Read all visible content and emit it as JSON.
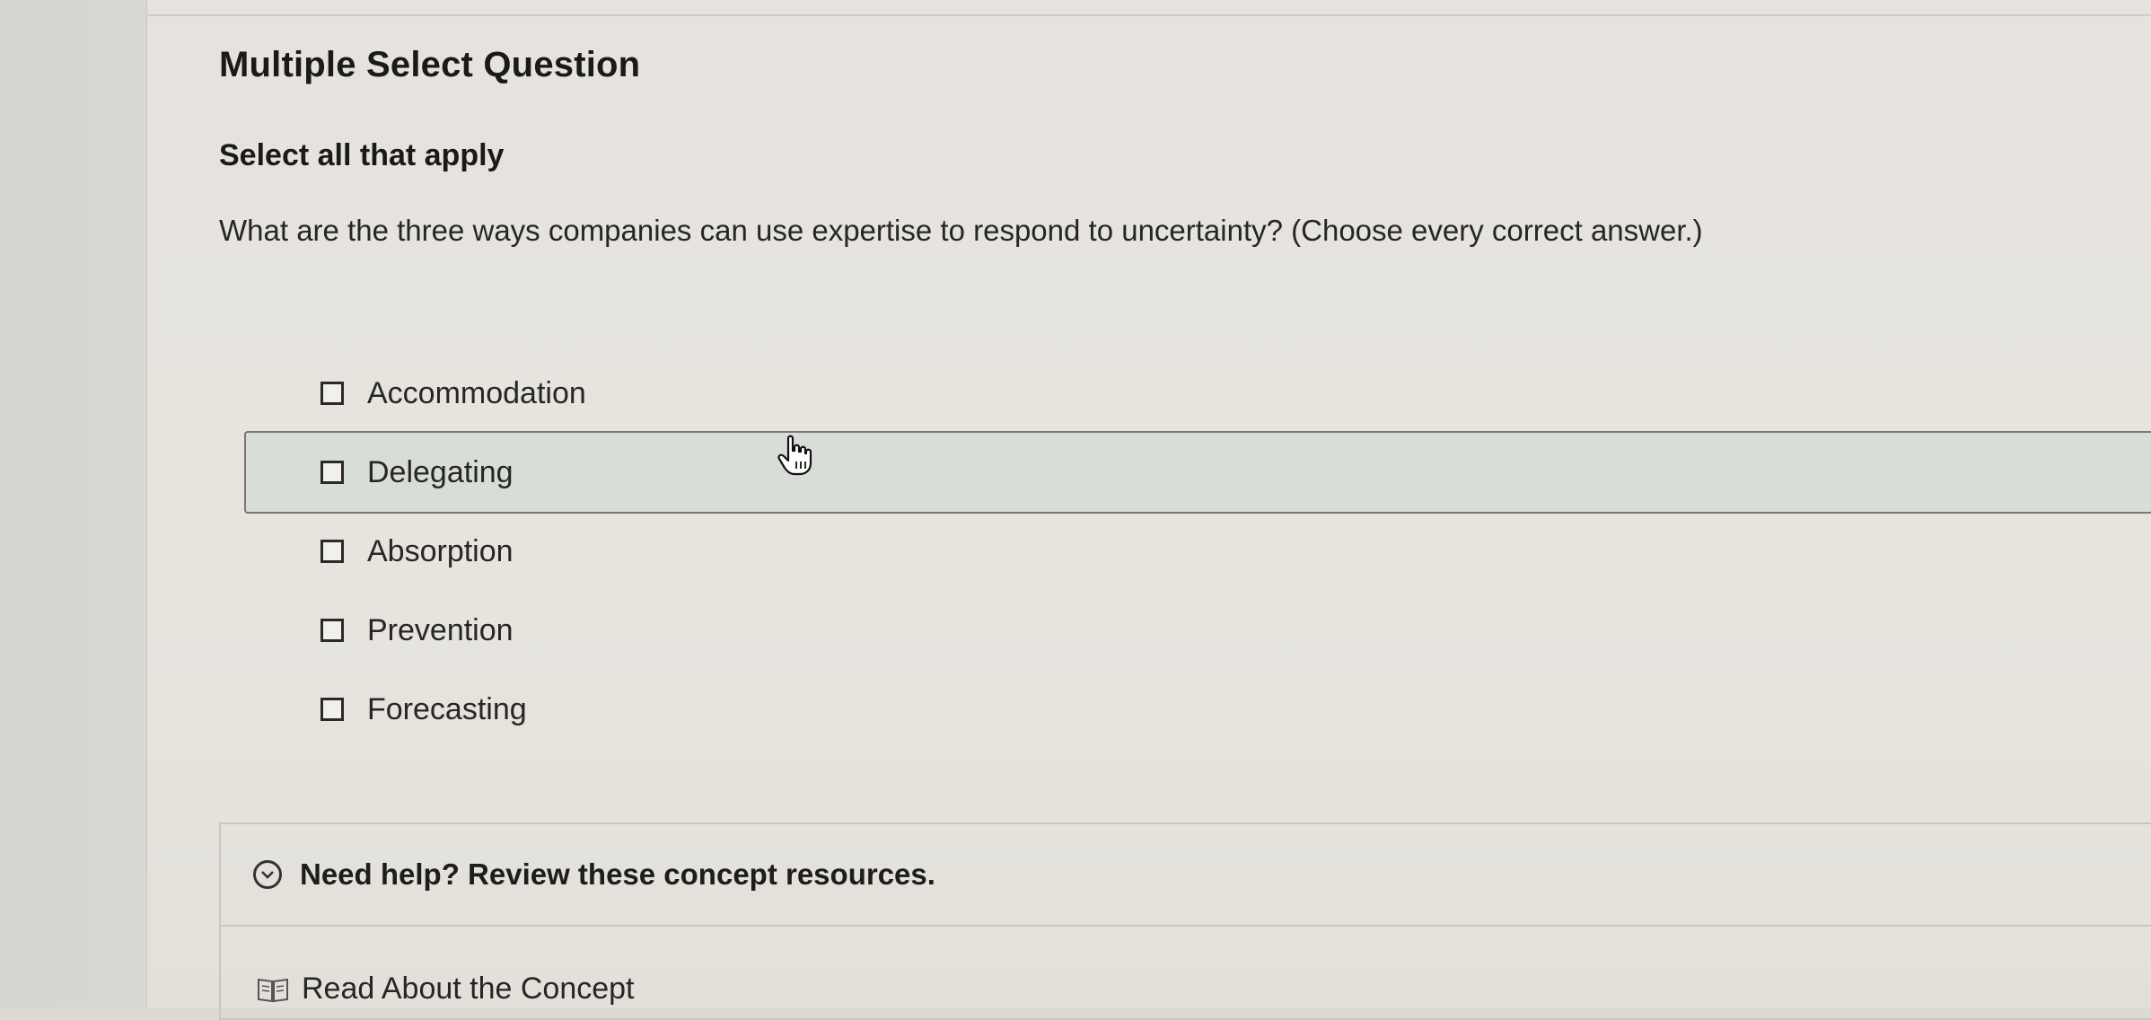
{
  "question": {
    "type_label": "Multiple Select Question",
    "instruction": "Select all that apply",
    "prompt": "What are the three ways companies can use expertise to respond to uncertainty? (Choose every correct answer.)"
  },
  "options": [
    {
      "label": "Accommodation",
      "checked": false
    },
    {
      "label": "Delegating",
      "checked": false,
      "hovered": true
    },
    {
      "label": "Absorption",
      "checked": false
    },
    {
      "label": "Prevention",
      "checked": false
    },
    {
      "label": "Forecasting",
      "checked": false
    }
  ],
  "help": {
    "title": "Need help? Review these concept resources.",
    "expand_icon": "chevron-down-circle-icon",
    "resources": [
      {
        "label": "Read About the Concept",
        "icon": "book-icon"
      }
    ]
  }
}
